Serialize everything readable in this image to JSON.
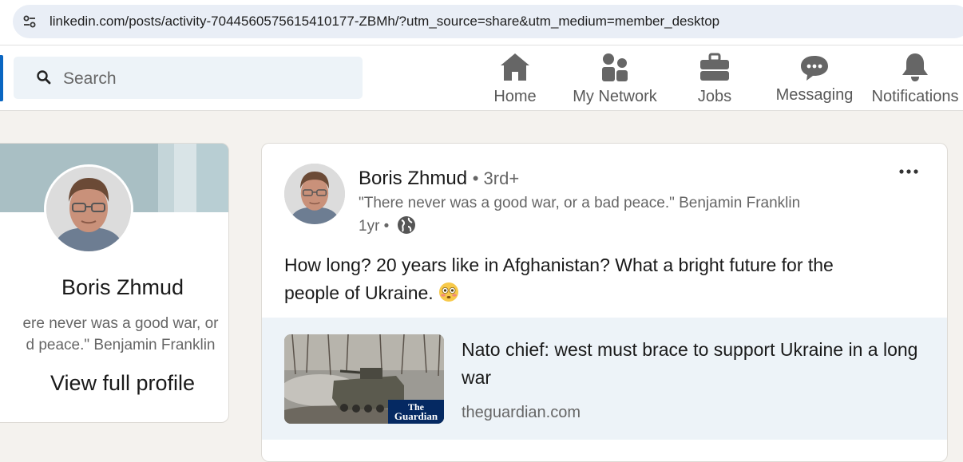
{
  "browser": {
    "url": "linkedin.com/posts/activity-7044560575615410177-ZBMh/?utm_source=share&utm_medium=member_desktop"
  },
  "nav": {
    "search_placeholder": "Search",
    "items": [
      {
        "label": "Home",
        "icon": "home-icon"
      },
      {
        "label": "My Network",
        "icon": "network-icon"
      },
      {
        "label": "Jobs",
        "icon": "briefcase-icon"
      },
      {
        "label": "Messaging",
        "icon": "messaging-icon"
      },
      {
        "label": "Notifications",
        "icon": "bell-icon"
      }
    ]
  },
  "profile_card": {
    "name": "Boris Zhmud",
    "headline_line1": "ere never was a good war, or",
    "headline_line2": "d peace.\" Benjamin Franklin",
    "view_profile": "View full profile"
  },
  "post": {
    "author": "Boris Zhmud",
    "degree": "• 3rd+",
    "headline": "\"There never was a good war, or a bad peace.\" Benjamin Franklin",
    "time": "1yr •",
    "text_line1": "How long? 20 years like in Afghanistan? What a bright future for the",
    "text_line2": "people of Ukraine.",
    "article": {
      "title": "Nato chief: west must brace to support Ukraine in a long war",
      "source": "theguardian.com",
      "logo_text_1": "The",
      "logo_text_2": "Guardian"
    }
  },
  "colors": {
    "linkedin_blue": "#0a66c2",
    "nav_gray": "#666666",
    "page_bg": "#f4f2ee",
    "article_bg": "#edf3f8"
  }
}
